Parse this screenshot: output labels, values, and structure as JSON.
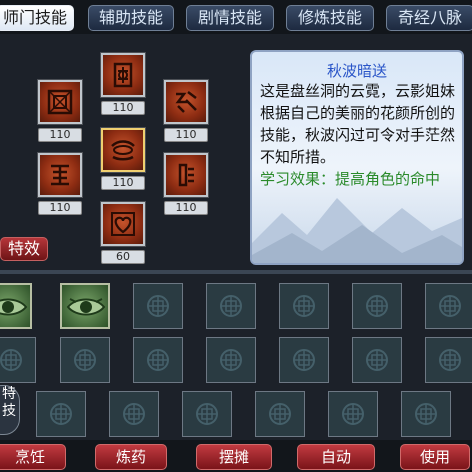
{
  "tabs": [
    {
      "label": "师门技能",
      "active": true
    },
    {
      "label": "辅助技能",
      "active": false
    },
    {
      "label": "剧情技能",
      "active": false
    },
    {
      "label": "修炼技能",
      "active": false
    },
    {
      "label": "奇经八脉",
      "active": false
    }
  ],
  "skills": [
    {
      "name": "skill-top",
      "icon": "gate-rune-icon",
      "level": "110"
    },
    {
      "name": "skill-left-1",
      "icon": "square-rune-icon",
      "level": "110"
    },
    {
      "name": "skill-right-1",
      "icon": "claw-rune-icon",
      "level": "110"
    },
    {
      "name": "skill-center",
      "icon": "eye-wave-rune-icon",
      "level": "110",
      "selected": true
    },
    {
      "name": "skill-left-2",
      "icon": "seal-rune-icon",
      "level": "110"
    },
    {
      "name": "skill-right-2",
      "icon": "figure-rune-icon",
      "level": "110"
    },
    {
      "name": "skill-bottom",
      "icon": "heart-rune-icon",
      "level": "60"
    }
  ],
  "description": {
    "title": "秋波暗送",
    "body": "这是盘丝洞的云霓，云影姐妹根据自己的美丽的花颜所创的技能，秋波闪过可令对手茫然不知所措。",
    "effect": "学习效果：提高角色的命中"
  },
  "effects_button": "特效",
  "special_tab": "特技",
  "bottom_buttons": [
    "烹饪",
    "炼药",
    "摆摊",
    "自动",
    "使用"
  ],
  "colors": {
    "accent_red": "#b6363a",
    "title_blue": "#2a55c8",
    "effect_green": "#2a8a2a"
  }
}
